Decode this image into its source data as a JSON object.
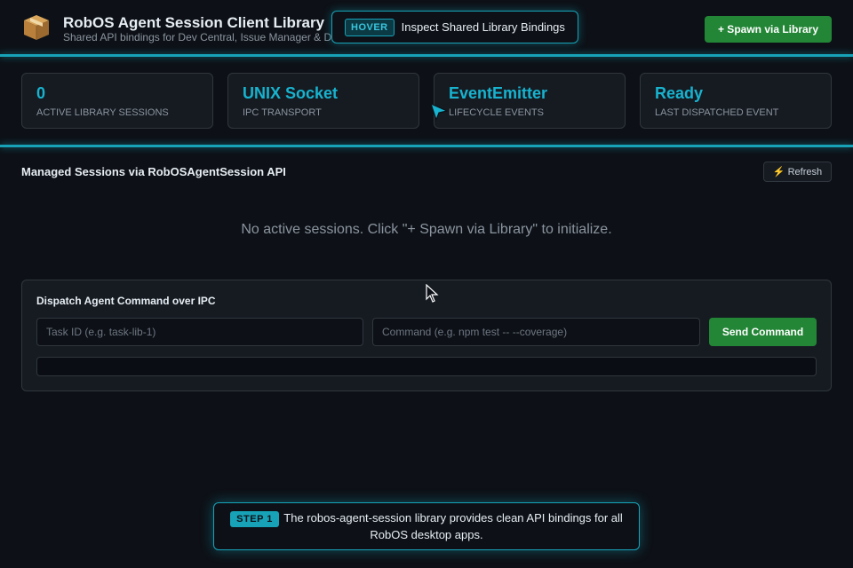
{
  "header": {
    "logo_icon": "package-icon",
    "title": "RobOS Agent Session Client Library",
    "subtitle": "Shared API bindings for Dev Central, Issue Manager & D",
    "spawn_label": "+ Spawn via Library"
  },
  "hover_tooltip": {
    "badge": "HOVER",
    "text": "Inspect Shared Library Bindings"
  },
  "stats": [
    {
      "value": "0",
      "label": "Active Library Sessions"
    },
    {
      "value": "UNIX Socket",
      "label": "IPC Transport"
    },
    {
      "value": "EventEmitter",
      "label": "Lifecycle Events"
    },
    {
      "value": "Ready",
      "label": "Last Dispatched Event"
    }
  ],
  "sessions": {
    "title": "Managed Sessions via RobOSAgentSession API",
    "refresh_icon": "lightning-icon",
    "refresh_label": "Refresh",
    "empty_message": "No active sessions. Click \"+ Spawn via Library\" to initialize."
  },
  "dispatch": {
    "title": "Dispatch Agent Command over IPC",
    "task_placeholder": "Task ID (e.g. task-lib-1)",
    "command_placeholder": "Command (e.g. npm test -- --coverage)",
    "send_label": "Send Command",
    "output": ""
  },
  "step_tooltip": {
    "badge": "STEP 1",
    "text": "The robos-agent-session library provides clean API bindings for all RobOS desktop apps."
  },
  "colors": {
    "accent": "#17a2b8",
    "primary_button": "#238636",
    "background": "#0d1117",
    "card": "#161b22"
  }
}
